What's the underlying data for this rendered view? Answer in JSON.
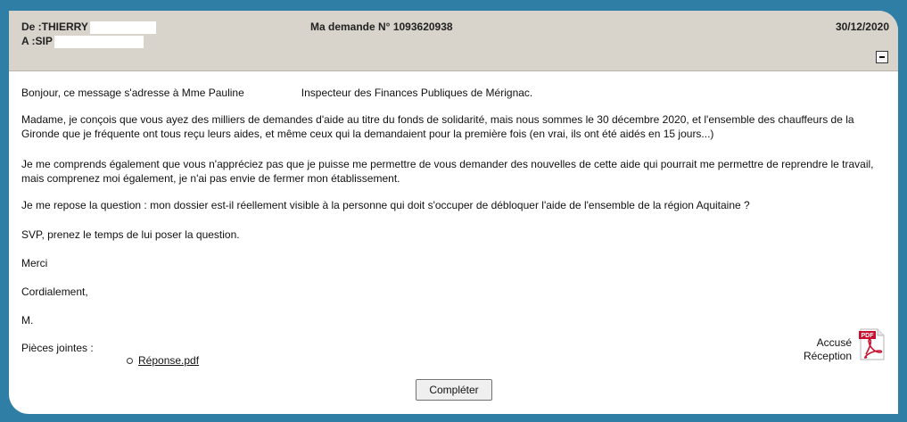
{
  "header": {
    "from": "De :THIERRY",
    "to": "A :SIP",
    "title": "Ma demande N° 1093620938",
    "date": "30/12/2020"
  },
  "message": {
    "p1_a": "Bonjour, ce message s'adresse à Mme Pauline",
    "p1_b": "Inspecteur des Finances Publiques de Mérignac.",
    "p2": "Madame, je conçois que vous ayez des milliers de demandes d'aide au titre du fonds de solidarité, mais nous sommes le 30 décembre 2020, et l'ensemble des chauffeurs de la Gironde que je fréquente ont tous reçu leurs aides, et même ceux qui la demandaient pour la première fois (en vrai, ils ont été aidés en 15 jours...)",
    "p3": "Je me comprends également que vous n'appréciez pas que je puisse me permettre de vous demander des nouvelles de cette aide qui pourrait me permettre de reprendre le travail, mais comprenez moi également, je n'ai pas envie de fermer mon établissement.",
    "p4": "Je me repose la question :  mon dossier est-il réellement visible à la personne qui doit s'occuper de débloquer l'aide de l'ensemble de la région Aquitaine ?",
    "p5": "SVP, prenez le temps de lui poser la question.",
    "p6": "Merci",
    "p7": "Cordialement,",
    "p8": "M."
  },
  "attachments": {
    "label": "Pièces jointes :",
    "files": [
      "Réponse.pdf"
    ]
  },
  "ack": {
    "line1": "Accusé",
    "line2": "Réception",
    "icon": "pdf-icon",
    "icon_text": "PDF"
  },
  "actions": {
    "complete_label": "Compléter"
  },
  "colors": {
    "background": "#2f7ea6",
    "header_bg": "#d8d3cb",
    "pdf_red": "#c8102e"
  }
}
